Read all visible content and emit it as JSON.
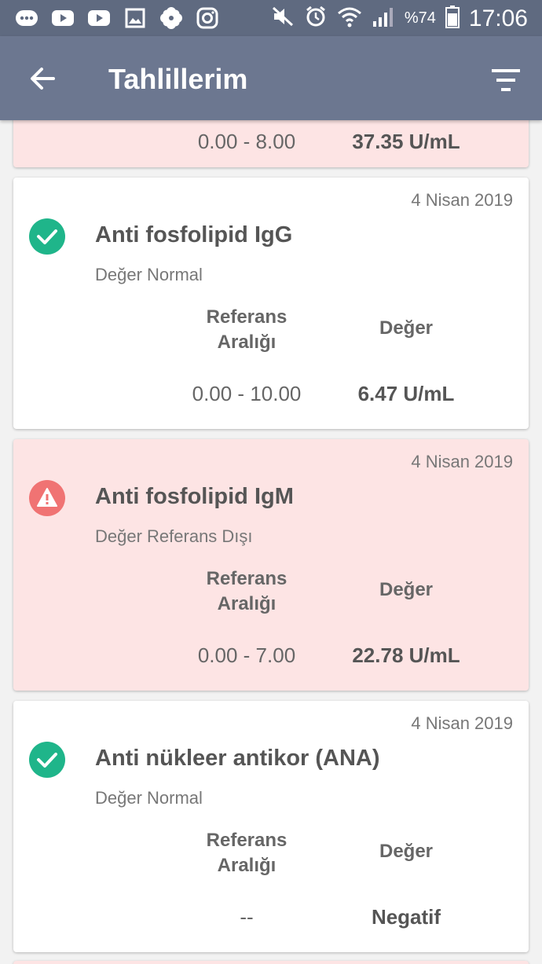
{
  "status_bar": {
    "battery": "%74",
    "time": "17:06"
  },
  "header": {
    "title": "Tahlillerim"
  },
  "cards": [
    {
      "status": "alert",
      "ref_range": "0.00  -  8.00",
      "value": "37.35 U/mL"
    },
    {
      "status": "normal",
      "date": "4 Nisan 2019",
      "name": "Anti fosfolipid IgG",
      "status_text": "Değer Normal",
      "ref_header_line1": "Referans",
      "ref_header_line2": "Aralığı",
      "value_header": "Değer",
      "ref_range": "0.00  -  10.00",
      "value": "6.47 U/mL"
    },
    {
      "status": "alert",
      "date": "4 Nisan 2019",
      "name": "Anti fosfolipid IgM",
      "status_text": "Değer Referans Dışı",
      "ref_header_line1": "Referans",
      "ref_header_line2": "Aralığı",
      "value_header": "Değer",
      "ref_range": "0.00  -  7.00",
      "value": "22.78 U/mL"
    },
    {
      "status": "normal",
      "date": "4 Nisan 2019",
      "name": "Anti nükleer antikor (ANA)",
      "status_text": "Değer Normal",
      "ref_header_line1": "Referans",
      "ref_header_line2": "Aralığı",
      "value_header": "Değer",
      "ref_range": "--",
      "value": "Negatif"
    }
  ],
  "colors": {
    "status_bar": "#5f6a80",
    "app_bar": "#6c7790",
    "normal_icon": "#1fb58a",
    "alert_icon": "#f07373",
    "alert_card": "#fde4e4"
  }
}
